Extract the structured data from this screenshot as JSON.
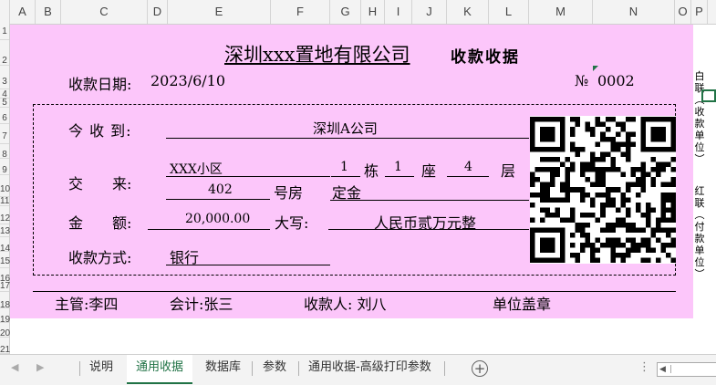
{
  "columns": [
    "A",
    "B",
    "C",
    "D",
    "E",
    "F",
    "G",
    "H",
    "I",
    "J",
    "K",
    "L",
    "M",
    "N",
    "O",
    "P"
  ],
  "rows": [
    "1",
    "2",
    "3",
    "4",
    "5",
    "6",
    "7",
    "8",
    "9",
    "10",
    "11",
    "12",
    "13",
    "14",
    "15",
    "16",
    "17",
    "18",
    "19",
    "20",
    "21"
  ],
  "receipt": {
    "company": "深圳xxx置地有限公司",
    "doc_title": "收款收据",
    "date_label": "收款日期:",
    "date_value": "2023/6/10",
    "number_label": "№",
    "number_value": "0002",
    "payer_label": "今 收 到:",
    "payer_value": "深圳A公司",
    "source_label": "交　　来:",
    "community": "XXX小区",
    "building": "1",
    "building_unit": "栋",
    "block": "1",
    "block_unit": "座",
    "floor": "4",
    "floor_unit": "层",
    "room": "402",
    "room_unit": "号房",
    "item": "定金",
    "amount_label": "金　　额:",
    "amount_value": "20,000.00",
    "amount_upper_label": "大写:",
    "amount_upper_value": "人民币贰万元整",
    "method_label": "收款方式:",
    "method_value": "银行",
    "supervisor": "主管:李四",
    "accountant": "会计:张三",
    "cashier": "收款人: 刘八",
    "seal": "单位盖章",
    "side_white": "白联(收款单位)",
    "side_red": "红联(付款单位)"
  },
  "sheet_tabs": [
    "说明",
    "通用收据",
    "数据库",
    "参数",
    "通用收据-高级打印参数"
  ],
  "active_tab": "通用收据",
  "colors": {
    "receipt_bg": "#fcc6fa",
    "active_tab": "#217346"
  }
}
